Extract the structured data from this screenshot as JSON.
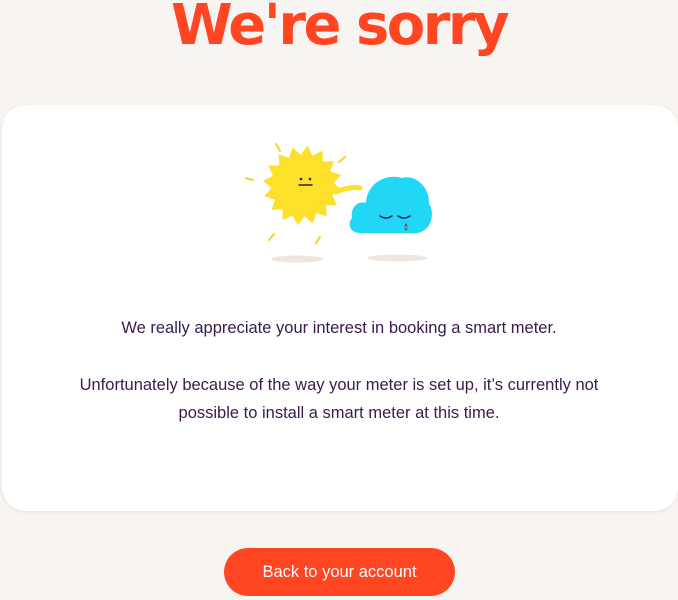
{
  "page": {
    "title": "We're sorry",
    "background_color": "#f8f4f1",
    "accent_color": "#ff4521",
    "text_color": "#3c1a4d"
  },
  "card": {
    "illustration": {
      "icons": [
        "sad-sun-icon",
        "crying-cloud-icon"
      ]
    },
    "message_1": "We really appreciate your interest in booking a smart meter.",
    "message_2": "Unfortunately because of the way your meter is set up, it’s currently not possible to install a smart meter at this time."
  },
  "actions": {
    "back_label": "Back to your account"
  }
}
